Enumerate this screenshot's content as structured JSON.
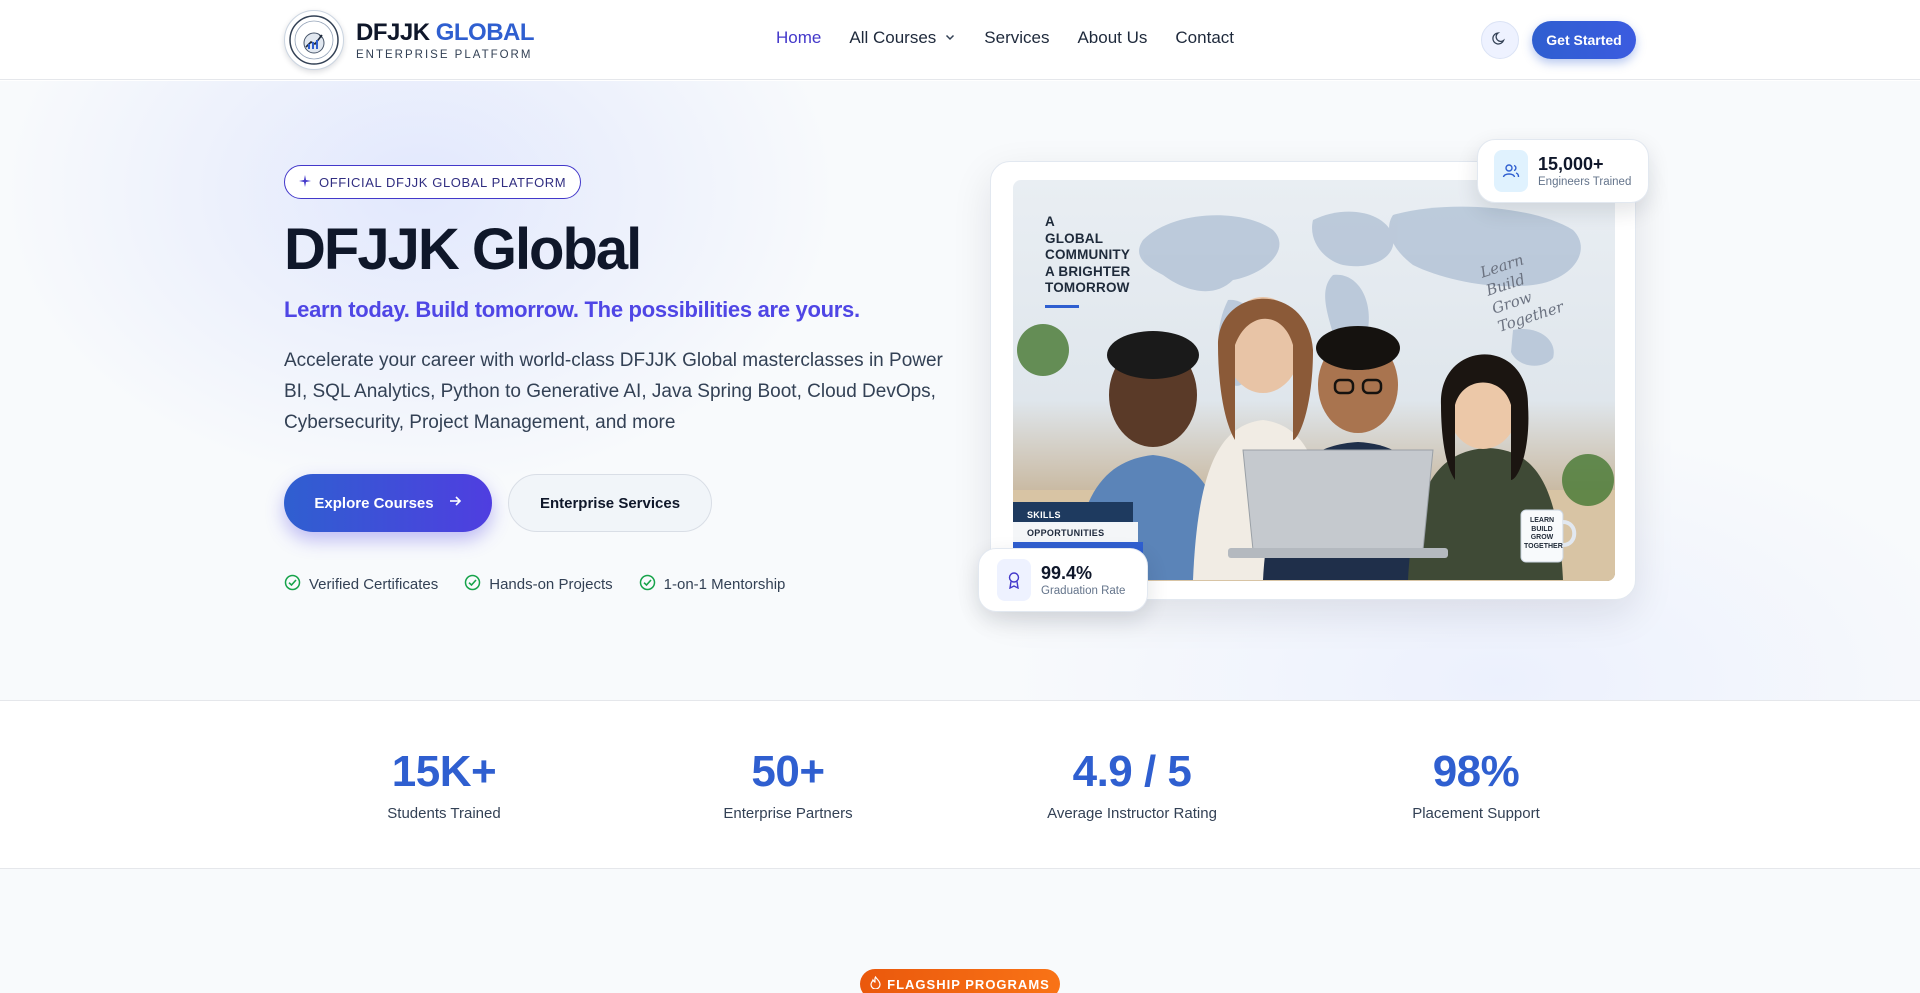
{
  "header": {
    "logo_name": "DFJJK",
    "logo_accent": "GLOBAL",
    "logo_sub": "ENTERPRISE PLATFORM",
    "logo_badge_text": "DFJJK",
    "nav": [
      {
        "label": "Home",
        "active": true
      },
      {
        "label": "All Courses",
        "dropdown": true
      },
      {
        "label": "Services"
      },
      {
        "label": "About Us"
      },
      {
        "label": "Contact"
      }
    ],
    "theme_toggle_icon": "moon-icon",
    "cta_label": "Get Started"
  },
  "hero": {
    "badge": "OFFICIAL DFJJK GLOBAL PLATFORM",
    "title": "DFJJK Global",
    "tagline": "Learn today. Build tomorrow. The possibilities are yours.",
    "description": "Accelerate your career with world-class DFJJK Global masterclasses in Power BI, SQL Analytics, Python to Generative AI, Java Spring Boot, Cloud DevOps, Cybersecurity, Project Management, and more",
    "primary_button": "Explore Courses",
    "secondary_button": "Enterprise Services",
    "features": [
      "Verified Certificates",
      "Hands-on Projects",
      "1-on-1 Mentorship"
    ],
    "photo": {
      "caption_lines": [
        "A",
        "GLOBAL",
        "COMMUNITY",
        "A BRIGHTER",
        "TOMORROW"
      ],
      "script_lines": [
        "Learn",
        "Build",
        "Grow",
        "Together"
      ],
      "books": [
        "SKILLS",
        "OPPORTUNITIES"
      ],
      "mug_lines": [
        "LEARN",
        "BUILD",
        "GROW",
        "TOGETHER"
      ]
    },
    "float_top": {
      "value": "15,000+",
      "label": "Engineers Trained",
      "icon": "users-icon"
    },
    "float_bottom": {
      "value": "99.4%",
      "label": "Graduation Rate",
      "icon": "award-icon"
    }
  },
  "stats": [
    {
      "value": "15K+",
      "label": "Students Trained"
    },
    {
      "value": "50+",
      "label": "Enterprise Partners"
    },
    {
      "value": "4.9 / 5",
      "label": "Average Instructor Rating"
    },
    {
      "value": "98%",
      "label": "Placement Support"
    }
  ],
  "lower": {
    "flagship_label": "FLAGSHIP PROGRAMS"
  },
  "colors": {
    "brand_blue": "#2f5fd0",
    "brand_indigo": "#4f46e5",
    "flagship_orange": "#ea580c",
    "check_green": "#16a34a"
  }
}
